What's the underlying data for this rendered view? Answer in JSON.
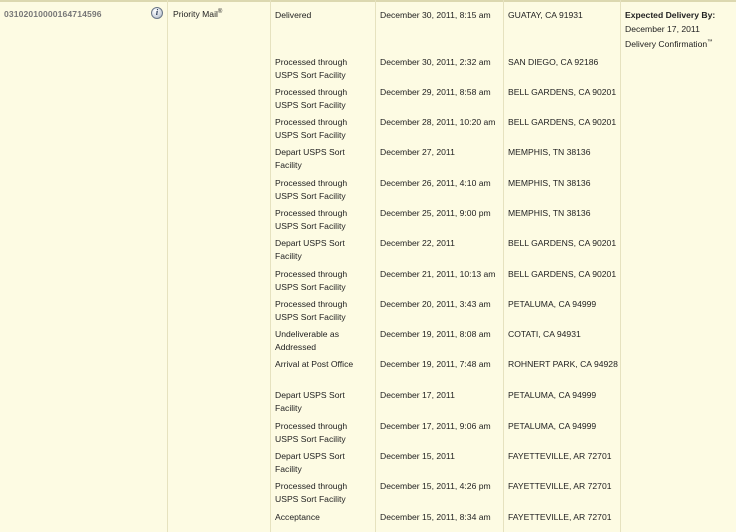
{
  "shipment": {
    "tracking_number": "03102010000164714596",
    "info_icon": "i",
    "service": "Priority Mail",
    "service_mark": "®"
  },
  "expected": {
    "title": "Expected Delivery By:",
    "date": "December 17, 2011",
    "confirmation": "Delivery Confirmation",
    "confirmation_mark": "™"
  },
  "events": [
    {
      "status": "Delivered",
      "date": "December 30, 2011, 8:15 am",
      "location": "GUATAY, CA 91931"
    },
    {
      "status": "Processed through USPS Sort Facility",
      "date": "December 30, 2011, 2:32 am",
      "location": "SAN DIEGO, CA 92186"
    },
    {
      "status": "Processed through USPS Sort Facility",
      "date": "December 29, 2011, 8:58 am",
      "location": "BELL GARDENS, CA 90201"
    },
    {
      "status": "Processed through USPS Sort Facility",
      "date": "December 28, 2011, 10:20 am",
      "location": "BELL GARDENS, CA 90201"
    },
    {
      "status": "Depart USPS Sort Facility",
      "date": "December 27, 2011",
      "location": "MEMPHIS, TN 38136"
    },
    {
      "status": "Processed through USPS Sort Facility",
      "date": "December 26, 2011, 4:10 am",
      "location": "MEMPHIS, TN 38136"
    },
    {
      "status": "Processed through USPS Sort Facility",
      "date": "December 25, 2011, 9:00 pm",
      "location": "MEMPHIS, TN 38136"
    },
    {
      "status": "Depart USPS Sort Facility",
      "date": "December 22, 2011",
      "location": "BELL GARDENS, CA 90201"
    },
    {
      "status": "Processed through USPS Sort Facility",
      "date": "December 21, 2011, 10:13 am",
      "location": "BELL GARDENS, CA 90201"
    },
    {
      "status": "Processed through USPS Sort Facility",
      "date": "December 20, 2011, 3:43 am",
      "location": "PETALUMA, CA 94999"
    },
    {
      "status": "Undeliverable as Addressed",
      "date": "December 19, 2011, 8:08 am",
      "location": "COTATI, CA 94931"
    },
    {
      "status": "Arrival at Post Office",
      "date": "December 19, 2011, 7:48 am",
      "location": "ROHNERT PARK, CA 94928"
    },
    {
      "status": "Depart USPS Sort Facility",
      "date": "December 17, 2011",
      "location": "PETALUMA, CA 94999"
    },
    {
      "status": "Processed through USPS Sort Facility",
      "date": "December 17, 2011, 9:06 am",
      "location": "PETALUMA, CA 94999"
    },
    {
      "status": "Depart USPS Sort Facility",
      "date": "December 15, 2011",
      "location": "FAYETTEVILLE, AR 72701"
    },
    {
      "status": "Processed through USPS Sort Facility",
      "date": "December 15, 2011, 4:26 pm",
      "location": "FAYETTEVILLE, AR 72701"
    },
    {
      "status": "Acceptance",
      "date": "December 15, 2011, 8:34 am",
      "location": "FAYETTEVILLE, AR 72701"
    }
  ]
}
